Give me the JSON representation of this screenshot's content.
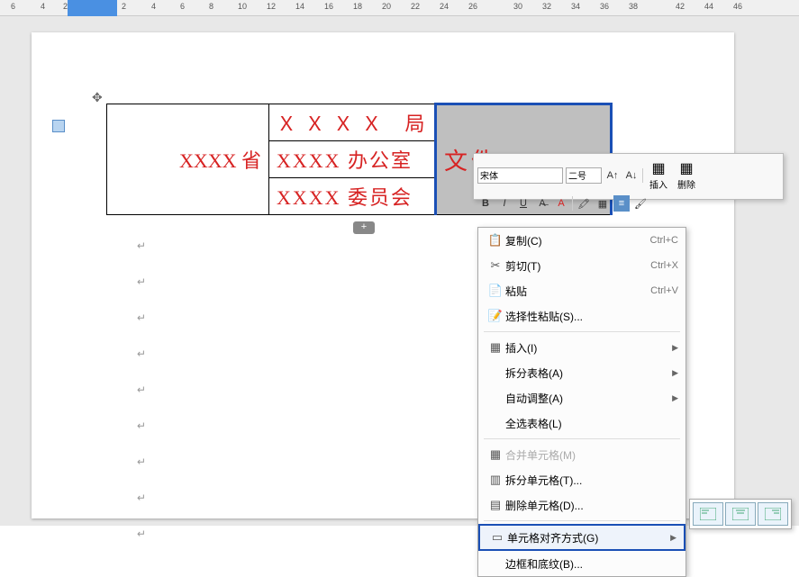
{
  "ruler": {
    "ticks": [
      "6",
      "4",
      "2",
      "2",
      "4",
      "6",
      "8",
      "10",
      "12",
      "14",
      "16",
      "18",
      "20",
      "22",
      "24",
      "26",
      "4",
      "16",
      "18",
      "20",
      "30",
      "32",
      "34",
      "36",
      "38",
      "4",
      "42",
      "44",
      "46"
    ]
  },
  "table": {
    "rows": [
      {
        "c1": "",
        "c2": "Ｘ Ｘ Ｘ Ｘ　局",
        "c3": "文件"
      },
      {
        "c1": "XXXX 省",
        "c2": "XXXX 办公室",
        "c3": ""
      },
      {
        "c1": "",
        "c2": "XXXX 委员会",
        "c3": ""
      }
    ]
  },
  "mini_toolbar": {
    "font_name": "宋体",
    "font_size": "二号",
    "inc": "A↑",
    "dec": "A↓",
    "bold": "B",
    "italic": "I",
    "underline": "U",
    "strike": "A",
    "color": "A",
    "highlight": "⬚",
    "insert": "插入",
    "delete": "删除"
  },
  "context_menu": {
    "items": [
      {
        "icon": "📋",
        "label": "复制(C)",
        "shortcut": "Ctrl+C"
      },
      {
        "icon": "✂",
        "label": "剪切(T)",
        "shortcut": "Ctrl+X"
      },
      {
        "icon": "📄",
        "label": "粘贴",
        "shortcut": "Ctrl+V"
      },
      {
        "icon": "📝",
        "label": "选择性粘贴(S)...",
        "shortcut": ""
      },
      {
        "sep": true
      },
      {
        "icon": "▦",
        "label": "插入(I)",
        "submenu": true
      },
      {
        "icon": "",
        "label": "拆分表格(A)",
        "submenu": true
      },
      {
        "icon": "",
        "label": "自动调整(A)",
        "submenu": true
      },
      {
        "icon": "",
        "label": "全选表格(L)",
        "shortcut": ""
      },
      {
        "sep": true
      },
      {
        "icon": "▦",
        "label": "合并单元格(M)",
        "disabled": true
      },
      {
        "icon": "▥",
        "label": "拆分单元格(T)...",
        "shortcut": ""
      },
      {
        "icon": "▤",
        "label": "删除单元格(D)...",
        "shortcut": ""
      },
      {
        "sep": true
      },
      {
        "icon": "▭",
        "label": "单元格对齐方式(G)",
        "submenu": true,
        "highlighted": true
      },
      {
        "icon": "",
        "label": "边框和底纹(B)...",
        "shortcut": ""
      }
    ]
  },
  "align_options": [
    "top-left",
    "top-center",
    "top-right"
  ]
}
